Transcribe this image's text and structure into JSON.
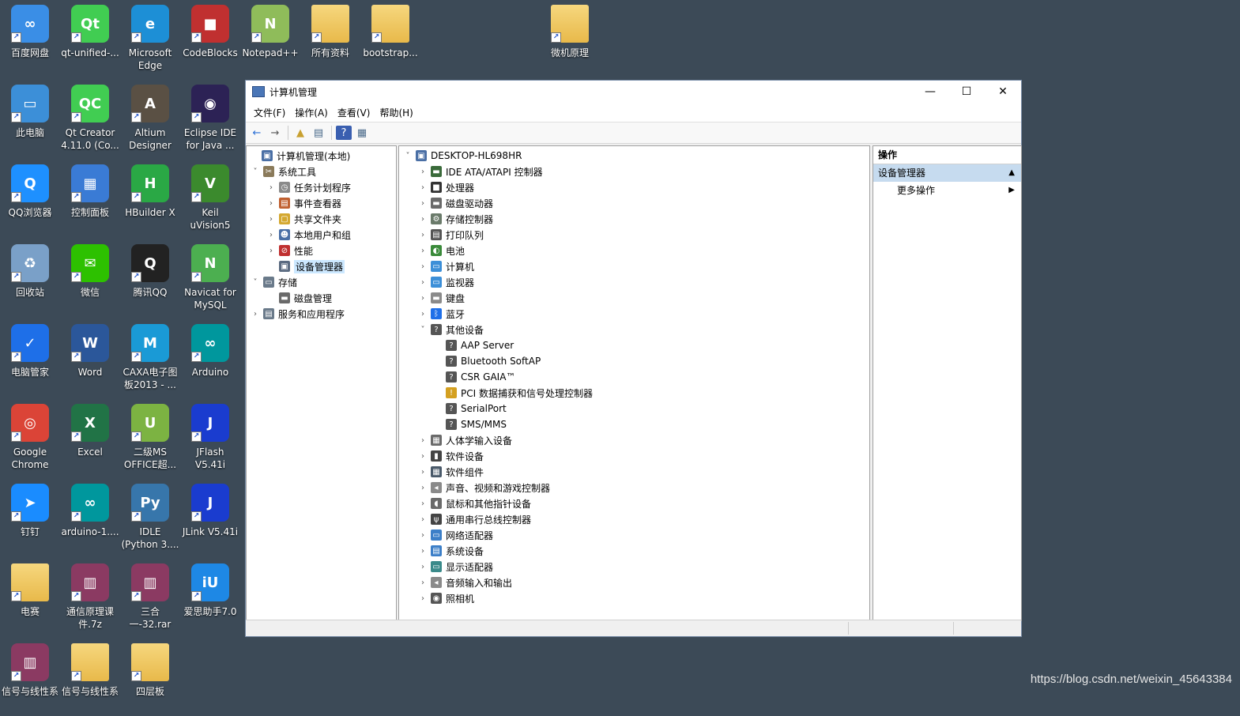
{
  "desktop": {
    "icons": [
      {
        "label": "百度网盘",
        "glyph": "∞",
        "color": "#3a8ee6"
      },
      {
        "label": "qt-unified-...",
        "glyph": "Qt",
        "color": "#41cd52"
      },
      {
        "label": "Microsoft\nEdge",
        "glyph": "e",
        "color": "#1d8fd6"
      },
      {
        "label": "CodeBlocks",
        "glyph": "■",
        "color": "#c03030"
      },
      {
        "label": "Notepad++",
        "glyph": "N",
        "color": "#8fbc5a"
      },
      {
        "label": "所有资料",
        "glyph": "",
        "color": "#e8b94a"
      },
      {
        "label": "bootstrap...",
        "glyph": "",
        "color": "#e8b94a"
      },
      {
        "label": "微机原理",
        "glyph": "",
        "color": "#e8b94a"
      },
      {
        "label": "此电脑",
        "glyph": "▭",
        "color": "#3c8fd8"
      },
      {
        "label": "Qt Creator\n4.11.0 (Co...",
        "glyph": "QC",
        "color": "#41cd52"
      },
      {
        "label": "Altium\nDesigner",
        "glyph": "A",
        "color": "#5a5044"
      },
      {
        "label": "Eclipse IDE\nfor Java ...",
        "glyph": "◉",
        "color": "#2c2255"
      },
      {
        "label": "QQ浏览器",
        "glyph": "Q",
        "color": "#1e90ff"
      },
      {
        "label": "控制面板",
        "glyph": "▦",
        "color": "#3a7bd5"
      },
      {
        "label": "HBuilder X",
        "glyph": "H",
        "color": "#2aa845"
      },
      {
        "label": "Keil\nuVision5",
        "glyph": "V",
        "color": "#3b8a2d"
      },
      {
        "label": "回收站",
        "glyph": "♻",
        "color": "#7aa0c8"
      },
      {
        "label": "微信",
        "glyph": "✉",
        "color": "#2dc100"
      },
      {
        "label": "腾讯QQ",
        "glyph": "Q",
        "color": "#222222"
      },
      {
        "label": "Navicat for\nMySQL",
        "glyph": "N",
        "color": "#4caf50"
      },
      {
        "label": "电脑管家",
        "glyph": "✓",
        "color": "#1e6fe8"
      },
      {
        "label": "Word",
        "glyph": "W",
        "color": "#2b579a"
      },
      {
        "label": "CAXA电子图\n板2013 - ...",
        "glyph": "M",
        "color": "#1a9ad6"
      },
      {
        "label": "Arduino",
        "glyph": "∞",
        "color": "#00979d"
      },
      {
        "label": "Google\nChrome",
        "glyph": "◎",
        "color": "#db4437"
      },
      {
        "label": "Excel",
        "glyph": "X",
        "color": "#217346"
      },
      {
        "label": "二级MS\nOFFICE超...",
        "glyph": "U",
        "color": "#7cb342"
      },
      {
        "label": "JFlash\nV5.41i",
        "glyph": "J",
        "color": "#1a3ccf"
      },
      {
        "label": "钉钉",
        "glyph": "➤",
        "color": "#1a8cff"
      },
      {
        "label": "arduino-1....",
        "glyph": "∞",
        "color": "#00979d"
      },
      {
        "label": "IDLE\n(Python 3....",
        "glyph": "Py",
        "color": "#3776ab"
      },
      {
        "label": "JLink V5.41i",
        "glyph": "J",
        "color": "#1a3ccf"
      },
      {
        "label": "电赛",
        "glyph": "",
        "color": "#e8b94a"
      },
      {
        "label": "通信原理课\n件.7z",
        "glyph": "▥",
        "color": "#8b3a62"
      },
      {
        "label": "三合一-32.rar",
        "glyph": "▥",
        "color": "#8b3a62"
      },
      {
        "label": "爱思助手7.0",
        "glyph": "iU",
        "color": "#1e88e5"
      },
      {
        "label": "信号与线性系",
        "glyph": "▥",
        "color": "#8b3a62"
      },
      {
        "label": "信号与线性系",
        "glyph": "",
        "color": "#e8b94a"
      },
      {
        "label": "四层板",
        "glyph": "",
        "color": "#e8b94a"
      }
    ]
  },
  "window": {
    "title": "计算机管理",
    "controls": {
      "minimize": "—",
      "maximize": "☐",
      "close": "✕"
    },
    "menu": [
      "文件(F)",
      "操作(A)",
      "查看(V)",
      "帮助(H)"
    ],
    "toolbar": [
      "←",
      "→",
      "▲",
      "▤",
      "?",
      "▦"
    ]
  },
  "left_tree": [
    {
      "label": "计算机管理(本地)",
      "expander": "",
      "icon": "▣",
      "color": "#4a6fa5"
    },
    {
      "label": "系统工具",
      "expander": "˅",
      "icon": "✂",
      "color": "#8a7a5a"
    },
    {
      "label": "任务计划程序",
      "expander": "›",
      "icon": "◷",
      "color": "#8a8a8a"
    },
    {
      "label": "事件查看器",
      "expander": "›",
      "icon": "▤",
      "color": "#c06030"
    },
    {
      "label": "共享文件夹",
      "expander": "›",
      "icon": "▢",
      "color": "#d4a830"
    },
    {
      "label": "本地用户和组",
      "expander": "›",
      "icon": "☻",
      "color": "#4a6fa5"
    },
    {
      "label": "性能",
      "expander": "›",
      "icon": "⊘",
      "color": "#c03030"
    },
    {
      "label": "设备管理器",
      "expander": "",
      "icon": "▣",
      "color": "#5a6a80"
    },
    {
      "label": "存储",
      "expander": "˅",
      "icon": "▭",
      "color": "#6a7a8a"
    },
    {
      "label": "磁盘管理",
      "expander": "",
      "icon": "▬",
      "color": "#6a6a6a"
    },
    {
      "label": "服务和应用程序",
      "expander": "›",
      "icon": "▤",
      "color": "#6a7a8a"
    }
  ],
  "device_tree": [
    {
      "label": "DESKTOP-HL698HR",
      "expander": "˅",
      "icon": "▣",
      "color": "#4a6fa5",
      "level": 0
    },
    {
      "label": "IDE ATA/ATAPI 控制器",
      "expander": "›",
      "icon": "▬",
      "color": "#3a6a3a",
      "level": 1
    },
    {
      "label": "处理器",
      "expander": "›",
      "icon": "■",
      "color": "#333333",
      "level": 1
    },
    {
      "label": "磁盘驱动器",
      "expander": "›",
      "icon": "▬",
      "color": "#6a6a6a",
      "level": 1
    },
    {
      "label": "存储控制器",
      "expander": "›",
      "icon": "⚙",
      "color": "#6a7a6a",
      "level": 1
    },
    {
      "label": "打印队列",
      "expander": "›",
      "icon": "▤",
      "color": "#555555",
      "level": 1
    },
    {
      "label": "电池",
      "expander": "›",
      "icon": "◐",
      "color": "#3a8a3a",
      "level": 1
    },
    {
      "label": "计算机",
      "expander": "›",
      "icon": "▭",
      "color": "#3c8fd8",
      "level": 1
    },
    {
      "label": "监视器",
      "expander": "›",
      "icon": "▭",
      "color": "#3c8fd8",
      "level": 1
    },
    {
      "label": "键盘",
      "expander": "›",
      "icon": "▬",
      "color": "#8a8a8a",
      "level": 1
    },
    {
      "label": "蓝牙",
      "expander": "›",
      "icon": "ᛒ",
      "color": "#1e6fe8",
      "level": 1
    },
    {
      "label": "其他设备",
      "expander": "˅",
      "icon": "?",
      "color": "#555555",
      "level": 1
    },
    {
      "label": "AAP Server",
      "expander": "",
      "icon": "?",
      "color": "#555555",
      "level": 2
    },
    {
      "label": "Bluetooth SoftAP",
      "expander": "",
      "icon": "?",
      "color": "#555555",
      "level": 2
    },
    {
      "label": "CSR GAIA™",
      "expander": "",
      "icon": "?",
      "color": "#555555",
      "level": 2
    },
    {
      "label": "PCI 数据捕获和信号处理控制器",
      "expander": "",
      "icon": "!",
      "color": "#d4a020",
      "level": 2
    },
    {
      "label": "SerialPort",
      "expander": "",
      "icon": "?",
      "color": "#555555",
      "level": 2
    },
    {
      "label": "SMS/MMS",
      "expander": "",
      "icon": "?",
      "color": "#555555",
      "level": 2
    },
    {
      "label": "人体学输入设备",
      "expander": "›",
      "icon": "▦",
      "color": "#6a6a6a",
      "level": 1
    },
    {
      "label": "软件设备",
      "expander": "›",
      "icon": "▮",
      "color": "#444444",
      "level": 1
    },
    {
      "label": "软件组件",
      "expander": "›",
      "icon": "▦",
      "color": "#4a5a6a",
      "level": 1
    },
    {
      "label": "声音、视频和游戏控制器",
      "expander": "›",
      "icon": "◂",
      "color": "#8a8a8a",
      "level": 1
    },
    {
      "label": "鼠标和其他指针设备",
      "expander": "›",
      "icon": "◖",
      "color": "#6a6a6a",
      "level": 1
    },
    {
      "label": "通用串行总线控制器",
      "expander": "›",
      "icon": "ψ",
      "color": "#444444",
      "level": 1
    },
    {
      "label": "网络适配器",
      "expander": "›",
      "icon": "▭",
      "color": "#3c7fc8",
      "level": 1
    },
    {
      "label": "系统设备",
      "expander": "›",
      "icon": "▤",
      "color": "#3c7fc8",
      "level": 1
    },
    {
      "label": "显示适配器",
      "expander": "›",
      "icon": "▭",
      "color": "#3a8a8a",
      "level": 1
    },
    {
      "label": "音频输入和输出",
      "expander": "›",
      "icon": "◂",
      "color": "#8a8a8a",
      "level": 1
    },
    {
      "label": "照相机",
      "expander": "›",
      "icon": "◉",
      "color": "#555555",
      "level": 1
    }
  ],
  "actions": {
    "header": "操作",
    "section": "设备管理器",
    "section_arrow": "▲",
    "more": "更多操作",
    "more_arrow": "▶"
  },
  "watermark": "https://blog.csdn.net/weixin_45643384"
}
